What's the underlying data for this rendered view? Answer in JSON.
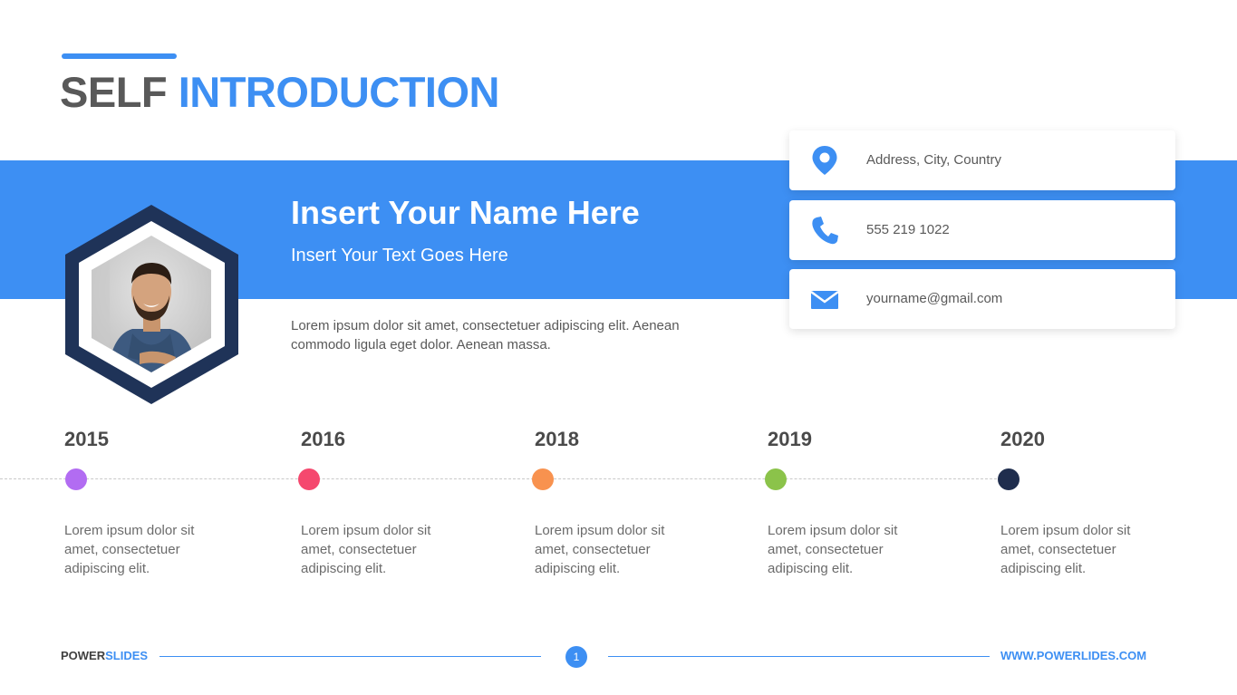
{
  "header": {
    "title_part1": "SELF",
    "title_part2": "INTRODUCTION"
  },
  "profile": {
    "name": "Insert Your Name Here",
    "subtitle": "Insert Your Text Goes Here",
    "description": "Lorem ipsum dolor sit amet, consectetuer adipiscing elit. Aenean commodo ligula eget dolor. Aenean massa.",
    "photo_icon": "person-photo"
  },
  "contacts": [
    {
      "icon": "location-pin-icon",
      "text": "Address, City, Country"
    },
    {
      "icon": "phone-icon",
      "text": "555 219 1022"
    },
    {
      "icon": "email-icon",
      "text": "yourname@gmail.com"
    }
  ],
  "timeline": [
    {
      "year": "2015",
      "color": "#b26cf2",
      "text": "Lorem ipsum dolor sit amet, consectetuer adipiscing elit."
    },
    {
      "year": "2016",
      "color": "#f5486e",
      "text": "Lorem ipsum dolor sit amet, consectetuer adipiscing elit."
    },
    {
      "year": "2018",
      "color": "#f8924f",
      "text": "Lorem ipsum dolor sit amet, consectetuer adipiscing elit."
    },
    {
      "year": "2019",
      "color": "#8bc34a",
      "text": "Lorem ipsum dolor sit amet, consectetuer adipiscing elit."
    },
    {
      "year": "2020",
      "color": "#1f2d4d",
      "text": "Lorem ipsum dolor sit amet, consectetuer adipiscing elit."
    }
  ],
  "footer": {
    "brand_part1": "POWER",
    "brand_part2": "SLIDES",
    "page_number": "1",
    "url": "WWW.POWERLIDES.COM"
  },
  "colors": {
    "accent": "#3d8ff3",
    "hex_frame": "#1f3358",
    "text": "#595959"
  }
}
